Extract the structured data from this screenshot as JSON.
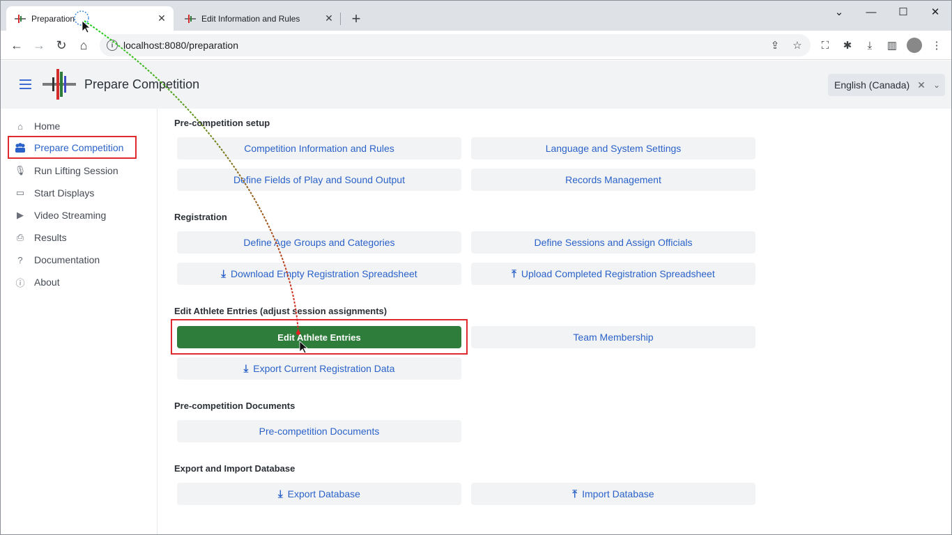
{
  "browser": {
    "tabs": [
      {
        "title": "Preparation",
        "active": true
      },
      {
        "title": "Edit Information and Rules",
        "active": false
      }
    ],
    "url": "localhost:8080/preparation"
  },
  "app": {
    "title": "Prepare Competition",
    "language": "English (Canada)"
  },
  "sidebar": {
    "items": [
      {
        "label": "Home",
        "icon": "home-icon"
      },
      {
        "label": "Prepare Competition",
        "icon": "users-icon",
        "selected": true
      },
      {
        "label": "Run Lifting Session",
        "icon": "microphone-icon"
      },
      {
        "label": "Start Displays",
        "icon": "monitor-icon"
      },
      {
        "label": "Video Streaming",
        "icon": "video-icon"
      },
      {
        "label": "Results",
        "icon": "printer-icon"
      },
      {
        "label": "Documentation",
        "icon": "question-icon"
      },
      {
        "label": "About",
        "icon": "info-icon"
      }
    ]
  },
  "sections": {
    "setup": {
      "heading": "Pre-competition setup",
      "buttons": [
        "Competition Information and Rules",
        "Language and System Settings",
        "Define Fields of Play and Sound Output",
        "Records Management"
      ]
    },
    "registration": {
      "heading": "Registration",
      "buttons": [
        "Define Age Groups and Categories",
        "Define Sessions and Assign Officials",
        "Download Empty Registration Spreadsheet",
        "Upload Completed Registration Spreadsheet"
      ]
    },
    "entries": {
      "heading": "Edit Athlete Entries (adjust session assignments)",
      "buttons": [
        "Edit Athlete Entries",
        "Team Membership",
        "Export Current Registration Data"
      ]
    },
    "documents": {
      "heading": "Pre-competition Documents",
      "buttons": [
        "Pre-competition Documents"
      ]
    },
    "database": {
      "heading": "Export and Import Database",
      "buttons": [
        "Export Database",
        "Import Database"
      ]
    }
  },
  "colors": {
    "accent": "#2a62c9",
    "primary_button": "#2e7d3b",
    "highlight": "#e0282e"
  }
}
